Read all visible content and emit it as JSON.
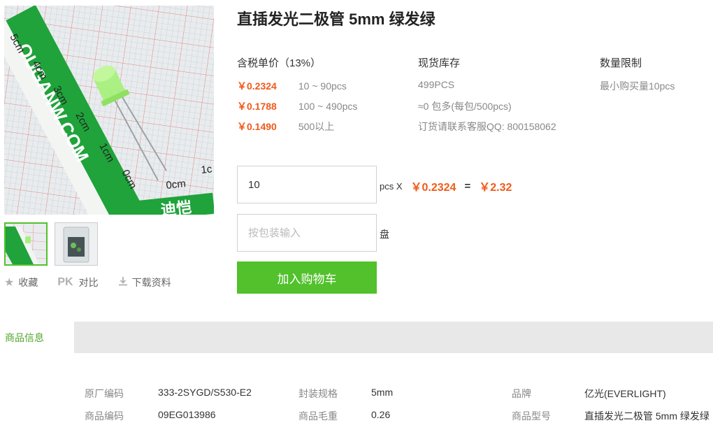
{
  "product": {
    "title": "直插发光二极管 5mm 绿发绿"
  },
  "gallery": {
    "image_ruler_labels": [
      "5cm",
      "4cm",
      "3cm",
      "2cm",
      "1cm",
      "0cm",
      "0cm",
      "1c"
    ],
    "image_brand_text": "OUGANW.COM",
    "image_logo_text": "迪恺"
  },
  "actions": {
    "favorite_label": "收藏",
    "pk_mark": "PK",
    "compare_label": "对比",
    "download_label": "下载资料"
  },
  "pricing": {
    "header": "含税单价（13%）",
    "tiers": [
      {
        "price": "￥0.2324",
        "range": "10 ~ 90pcs"
      },
      {
        "price": "￥0.1788",
        "range": "100 ~ 490pcs"
      },
      {
        "price": "￥0.1490",
        "range": "500以上"
      }
    ]
  },
  "stock": {
    "header": "现货库存",
    "quantity": "499PCS",
    "packages": "≈0 包多(每包/500pcs)",
    "order_note": "订货请联系客服QQ: 800158062"
  },
  "limit": {
    "header": "数量限制",
    "min_purchase": "最小购买量10pcs"
  },
  "order": {
    "quantity_value": "10",
    "unit_label": "pcs X",
    "unit_price": "￥0.2324",
    "equals": "=",
    "total": "￥2.32",
    "package_placeholder": "按包装输入",
    "package_unit": "盘",
    "add_to_cart_label": "加入购物车"
  },
  "tabs": {
    "active_label": "商品信息"
  },
  "specs": {
    "rows": [
      [
        {
          "key": "原厂编码",
          "value": "333-2SYGD/S530-E2"
        },
        {
          "key": "封装规格",
          "value": "5mm"
        },
        {
          "key": "品牌",
          "value": "亿光(EVERLIGHT)"
        }
      ],
      [
        {
          "key": "商品编码",
          "value": "09EG013986"
        },
        {
          "key": "商品毛重",
          "value": "0.26"
        },
        {
          "key": "商品型号",
          "value": "直插发光二极管 5mm 绿发绿"
        }
      ]
    ]
  },
  "colors": {
    "accent_green": "#52c12c",
    "price_orange": "#f05a1a"
  }
}
